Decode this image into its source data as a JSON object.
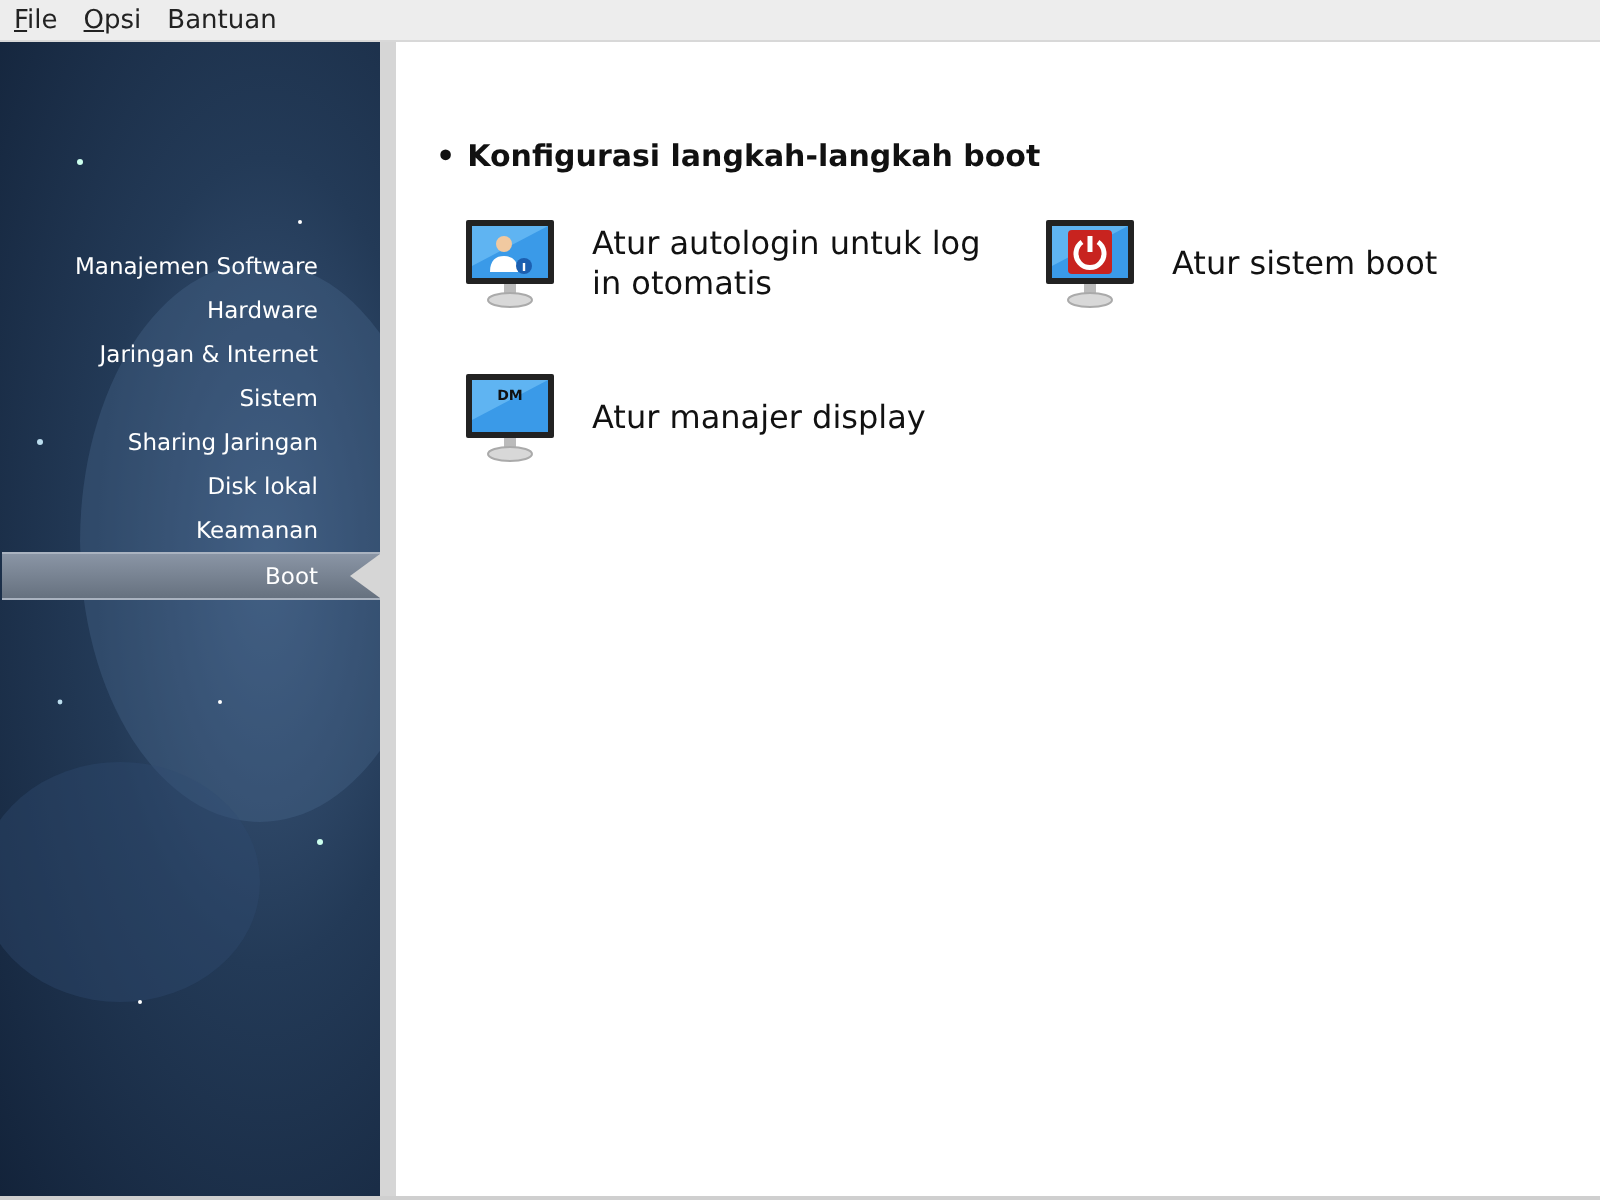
{
  "menu": [
    {
      "label": "File",
      "mnemonic": true
    },
    {
      "label": "Opsi",
      "mnemonic": true
    },
    {
      "label": "Bantuan",
      "mnemonic": false
    }
  ],
  "sidebar": {
    "items": [
      {
        "label": "Manajemen Software",
        "selected": false
      },
      {
        "label": "Hardware",
        "selected": false
      },
      {
        "label": "Jaringan & Internet",
        "selected": false
      },
      {
        "label": "Sistem",
        "selected": false
      },
      {
        "label": "Sharing Jaringan",
        "selected": false
      },
      {
        "label": "Disk lokal",
        "selected": false
      },
      {
        "label": "Keamanan",
        "selected": false
      },
      {
        "label": "Boot",
        "selected": true
      }
    ]
  },
  "section": {
    "bullet": "•",
    "title": "Konfigurasi langkah-langkah boot",
    "tools": [
      {
        "label": "Atur autologin untuk log in otomatis",
        "icon": {
          "kind": "user"
        }
      },
      {
        "label": "Atur sistem boot",
        "icon": {
          "kind": "power"
        }
      },
      {
        "label": "Atur manajer display",
        "icon": {
          "kind": "text",
          "text": "DM"
        }
      }
    ]
  }
}
